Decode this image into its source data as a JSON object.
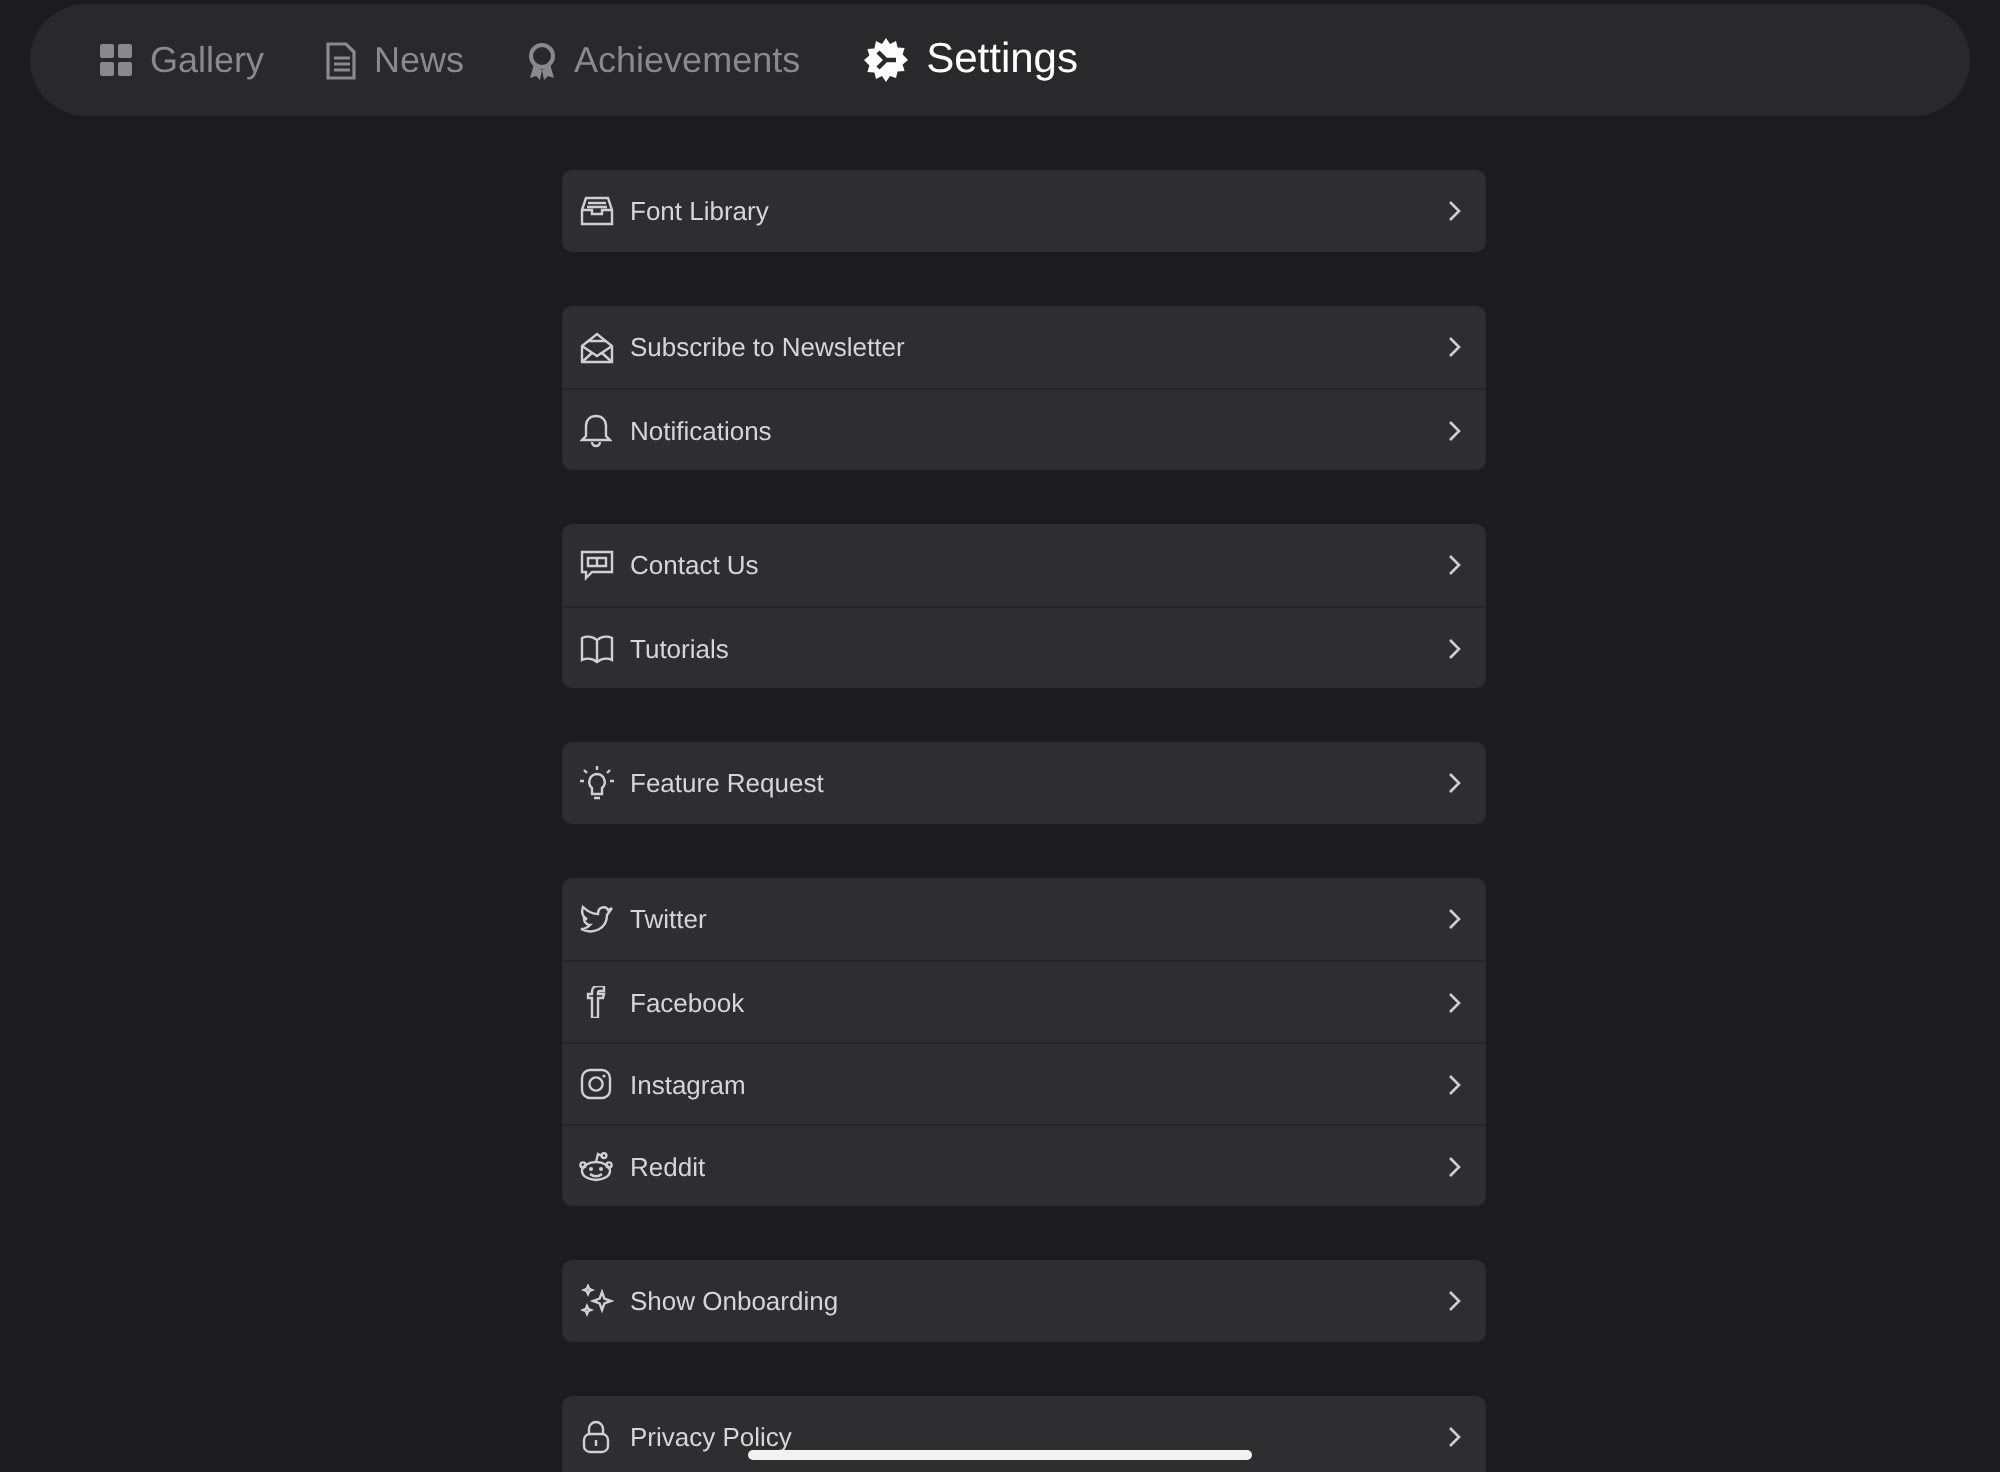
{
  "tabs": [
    {
      "label": "Gallery",
      "selected": false
    },
    {
      "label": "News",
      "selected": false
    },
    {
      "label": "Achievements",
      "selected": false
    },
    {
      "label": "Settings",
      "selected": true
    }
  ],
  "settings_groups": [
    {
      "items": [
        {
          "label": "Font Library"
        }
      ]
    },
    {
      "items": [
        {
          "label": "Subscribe to Newsletter"
        },
        {
          "label": "Notifications"
        }
      ]
    },
    {
      "items": [
        {
          "label": "Contact Us"
        },
        {
          "label": "Tutorials"
        }
      ]
    },
    {
      "items": [
        {
          "label": "Feature Request"
        }
      ]
    },
    {
      "items": [
        {
          "label": "Twitter"
        },
        {
          "label": "Facebook"
        },
        {
          "label": "Instagram"
        },
        {
          "label": "Reddit"
        }
      ]
    },
    {
      "items": [
        {
          "label": "Show Onboarding"
        }
      ]
    },
    {
      "items": [
        {
          "label": "Privacy Policy"
        }
      ]
    }
  ]
}
